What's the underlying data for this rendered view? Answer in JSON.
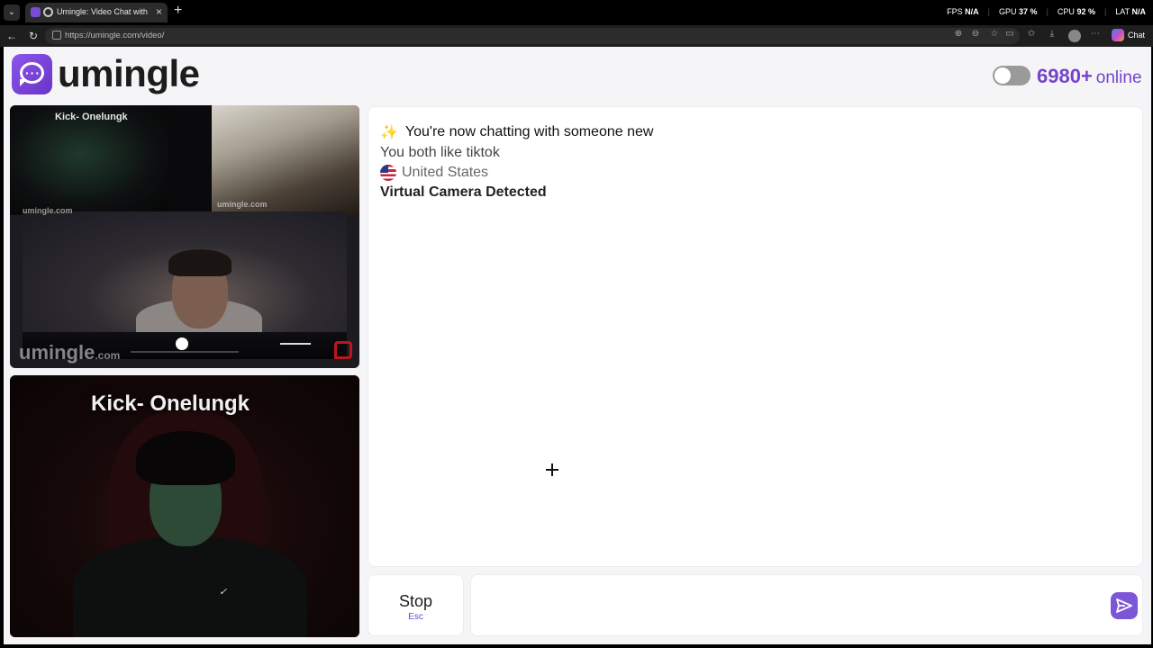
{
  "browser": {
    "tab_title": "Umingle: Video Chat with Str...",
    "url": "https://umingle.com/video/",
    "stats": [
      {
        "label": "FPS",
        "value": "N/A"
      },
      {
        "label": "GPU",
        "value": "37 %"
      },
      {
        "label": "CPU",
        "value": "92 %"
      },
      {
        "label": "LAT",
        "value": "N/A"
      }
    ],
    "chat_label": "Chat"
  },
  "header": {
    "brand": "umingle",
    "online_count": "6980+",
    "online_label": "online"
  },
  "videos": {
    "top_streamer_label": "Kick- Onelungk",
    "bottom_streamer_label": "Kick- Onelungk",
    "watermark": "umingle",
    "watermark_suffix": ".com"
  },
  "chat": {
    "messages": {
      "intro": "You're now chatting with someone new",
      "shared_interest": "You both like tiktok",
      "country": "United States",
      "warning": "Virtual Camera Detected"
    },
    "input_placeholder": ""
  },
  "controls": {
    "stop_label": "Stop",
    "stop_key": "Esc"
  },
  "colors": {
    "accent": "#7444c9",
    "page_bg": "#f5f5f7",
    "send_bg": "#7d56d8"
  }
}
